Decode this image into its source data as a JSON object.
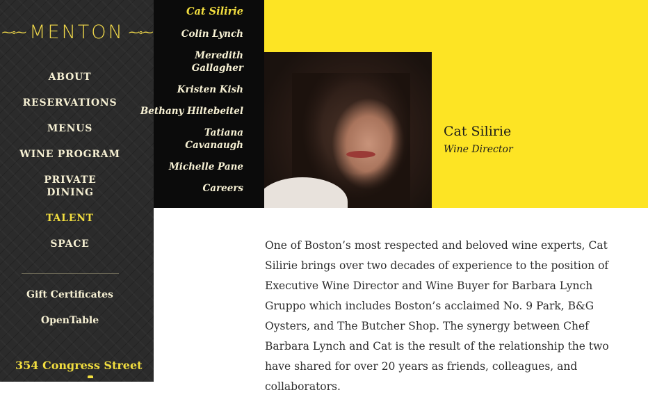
{
  "logo": {
    "text": "MENTON",
    "flourish_left": "⁓∘⁓",
    "flourish_right": "⁓∘⁓"
  },
  "nav": [
    {
      "label": "ABOUT",
      "active": false
    },
    {
      "label": "RESERVATIONS",
      "active": false
    },
    {
      "label": "MENUS",
      "active": false
    },
    {
      "label": "WINE PROGRAM",
      "active": false
    },
    {
      "label": "PRIVATE DINING",
      "active": false
    },
    {
      "label": "TALENT",
      "active": true
    },
    {
      "label": "SPACE",
      "active": false
    }
  ],
  "secondary": [
    {
      "label": "Gift Certificates"
    },
    {
      "label": "OpenTable"
    }
  ],
  "address": "354 Congress Street",
  "talent": [
    {
      "label": "Cat Silirie",
      "active": true
    },
    {
      "label": "Colin Lynch"
    },
    {
      "label": "Meredith\nGallagher"
    },
    {
      "label": "Kristen Kish"
    },
    {
      "label": "Bethany Hiltebeitel"
    },
    {
      "label": "Tatiana\nCavanaugh"
    },
    {
      "label": "Michelle Pane"
    },
    {
      "label": "Careers"
    }
  ],
  "profile": {
    "name": "Cat Silirie",
    "role": "Wine Director"
  },
  "bio": "One of Boston’s most respected and beloved wine experts, Cat Silirie brings over two decades of experience to the position of Executive Wine Director and Wine Buyer for Barbara Lynch Gruppo which includes Boston’s acclaimed No. 9 Park, B&G Oysters, and The Butcher Shop. The synergy between Chef Barbara Lynch and Cat is the result of the relationship the two have shared for over 20 years as friends, colleagues, and collaborators.",
  "colors": {
    "accent": "#fde424",
    "sidebar": "#2b2b2b",
    "talent_bg": "#0b0b0b"
  }
}
